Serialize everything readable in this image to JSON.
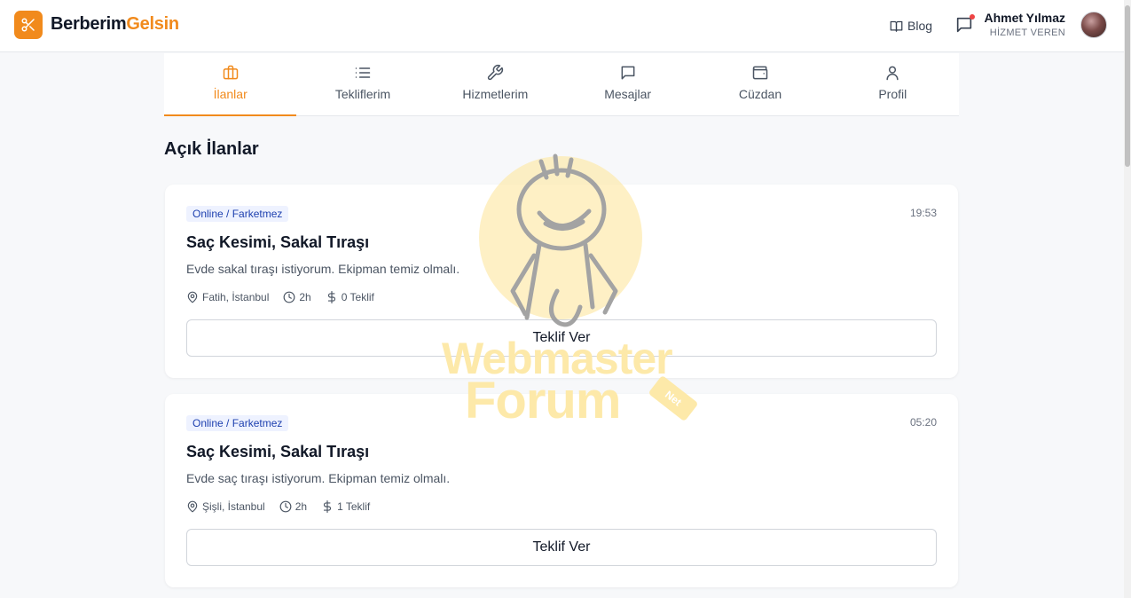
{
  "app": {
    "brand_part1": "Berberim",
    "brand_part2": "Gelsin"
  },
  "header": {
    "blog_label": "Blog",
    "user_name": "Ahmet Yılmaz",
    "user_role": "HİZMET VEREN"
  },
  "tabs": [
    {
      "label": "İlanlar",
      "icon": "briefcase-icon",
      "active": true
    },
    {
      "label": "Tekliflerim",
      "icon": "list-icon",
      "active": false
    },
    {
      "label": "Hizmetlerim",
      "icon": "wrench-icon",
      "active": false
    },
    {
      "label": "Mesajlar",
      "icon": "chat-icon",
      "active": false
    },
    {
      "label": "Cüzdan",
      "icon": "wallet-icon",
      "active": false
    },
    {
      "label": "Profil",
      "icon": "user-icon",
      "active": false
    }
  ],
  "section_title": "Açık İlanlar",
  "listings": [
    {
      "badge": "Online / Farketmez",
      "time": "19:53",
      "title": "Saç Kesimi, Sakal Tıraşı",
      "description": "Evde sakal tıraşı istiyorum. Ekipman temiz olmalı.",
      "location": "Fatih, İstanbul",
      "duration": "2h",
      "offers": "0 Teklif",
      "button": "Teklif Ver"
    },
    {
      "badge": "Online / Farketmez",
      "time": "05:20",
      "title": "Saç Kesimi, Sakal Tıraşı",
      "description": "Evde saç tıraşı istiyorum. Ekipman temiz olmalı.",
      "location": "Şişli, İstanbul",
      "duration": "2h",
      "offers": "1 Teklif",
      "button": "Teklif Ver"
    }
  ],
  "watermark": {
    "line1": "Webmaster",
    "line2": "Forum",
    "tag": "Net"
  },
  "colors": {
    "accent": "#f18a1c",
    "badge_bg": "#eef2ff",
    "badge_text": "#1e40af",
    "notif": "#ef4444"
  }
}
